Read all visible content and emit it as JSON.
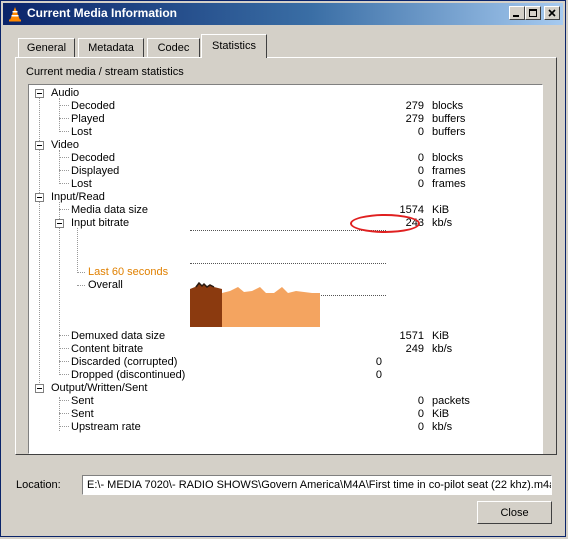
{
  "window": {
    "title": "Current Media Information",
    "icon": "vlc-cone-icon"
  },
  "tabs": [
    {
      "label": "General"
    },
    {
      "label": "Metadata"
    },
    {
      "label": "Codec"
    },
    {
      "label": "Statistics",
      "active": true
    }
  ],
  "section_label": "Current media / stream statistics",
  "stats": {
    "audio": {
      "label": "Audio",
      "decoded": {
        "label": "Decoded",
        "value": "279",
        "unit": "blocks"
      },
      "played": {
        "label": "Played",
        "value": "279",
        "unit": "buffers"
      },
      "lost": {
        "label": "Lost",
        "value": "0",
        "unit": "buffers"
      }
    },
    "video": {
      "label": "Video",
      "decoded": {
        "label": "Decoded",
        "value": "0",
        "unit": "blocks"
      },
      "displayed": {
        "label": "Displayed",
        "value": "0",
        "unit": "frames"
      },
      "lost": {
        "label": "Lost",
        "value": "0",
        "unit": "frames"
      }
    },
    "input": {
      "label": "Input/Read",
      "media_data_size": {
        "label": "Media data size",
        "value": "1574",
        "unit": "KiB"
      },
      "input_bitrate": {
        "label": "Input bitrate",
        "value": "243",
        "unit": "kb/s"
      },
      "graph_period": "Last 60 seconds",
      "graph_overall": "Overall",
      "demuxed_data_size": {
        "label": "Demuxed data size",
        "value": "1571",
        "unit": "KiB"
      },
      "content_bitrate": {
        "label": "Content bitrate",
        "value": "249",
        "unit": "kb/s"
      },
      "discarded": {
        "label": "Discarded (corrupted)",
        "value": "0"
      },
      "dropped": {
        "label": "Dropped (discontinued)",
        "value": "0"
      }
    },
    "output": {
      "label": "Output/Written/Sent",
      "sent_packets": {
        "label": "Sent",
        "value": "0",
        "unit": "packets"
      },
      "sent_size": {
        "label": "Sent",
        "value": "0",
        "unit": "KiB"
      },
      "upstream_rate": {
        "label": "Upstream rate",
        "value": "0",
        "unit": "kb/s"
      }
    }
  },
  "location": {
    "label": "Location:",
    "value": "E:\\- MEDIA 7020\\- RADIO SHOWS\\Govern America\\M4A\\First time in co-pilot seat (22 khz).m4a"
  },
  "close_label": "Close",
  "colors": {
    "graph_overall": "#f4a460",
    "graph_recent": "#8b3a0f",
    "graph_peak": "#2a1a10",
    "period_label": "#e08000",
    "highlight": "#e02020"
  }
}
